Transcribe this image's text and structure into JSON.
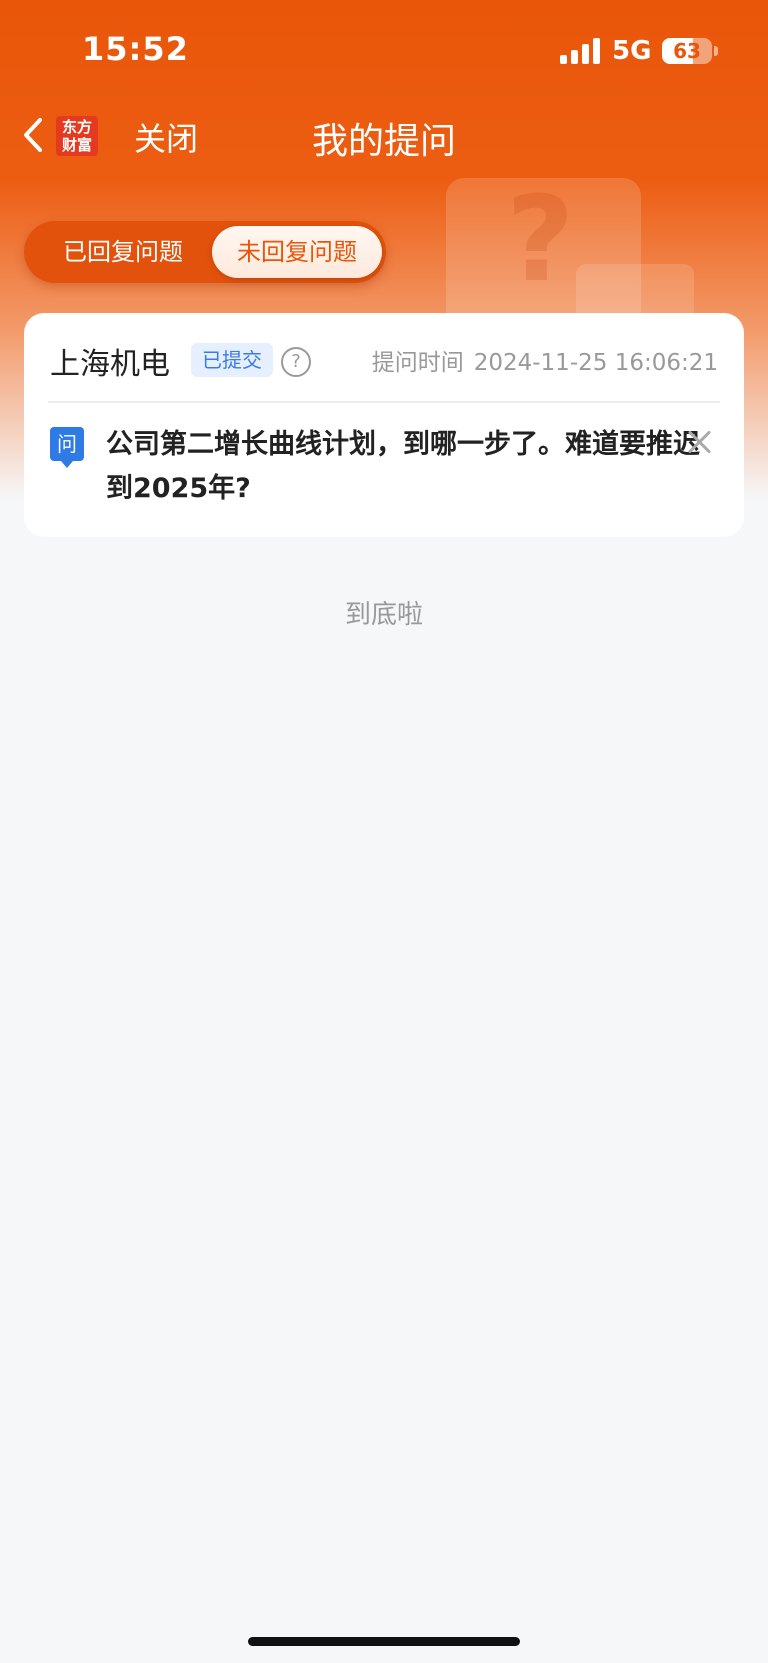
{
  "status_bar": {
    "time": "15:52",
    "network": "5G",
    "battery": "63"
  },
  "nav": {
    "logo_line1": "东方",
    "logo_line2": "财富",
    "close_label": "关闭",
    "title": "我的提问"
  },
  "tabs": [
    {
      "label": "已回复问题",
      "active": false
    },
    {
      "label": "未回复问题",
      "active": true
    }
  ],
  "questions": [
    {
      "company": "上海机电",
      "status": "已提交",
      "help_icon": "?",
      "time_label": "提问时间",
      "time": "2024-11-25 16:06:21",
      "question_icon": "问",
      "text": "公司第二增长曲线计划，到哪一步了。难道要推迟到2025年?"
    }
  ],
  "footer": {
    "end_text": "到底啦"
  },
  "colors": {
    "brand": "#e9560a",
    "accent_blue": "#2f7be6",
    "background": "#f6f7f9"
  }
}
